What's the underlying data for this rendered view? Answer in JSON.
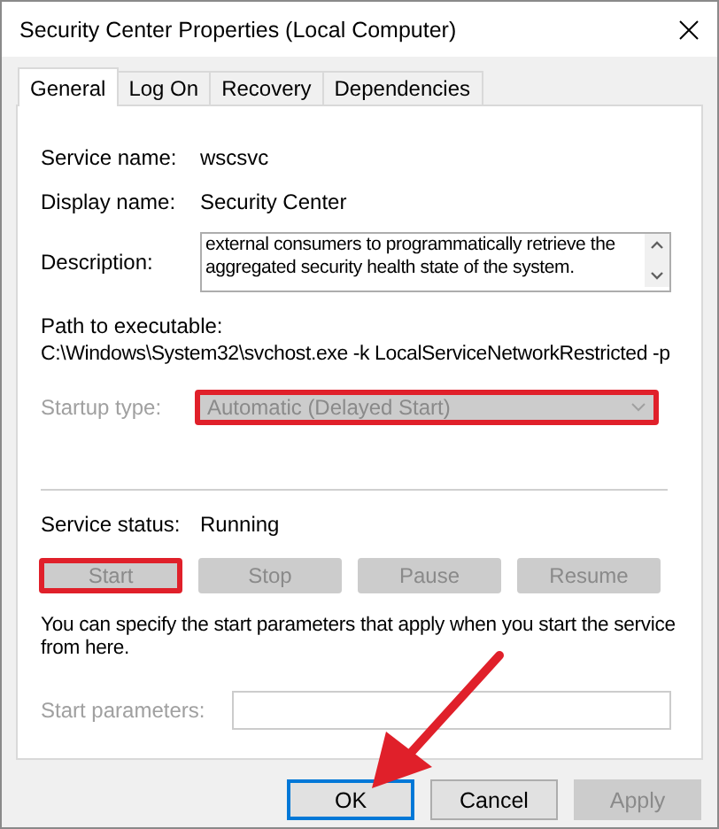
{
  "window": {
    "title": "Security Center Properties (Local Computer)"
  },
  "tabs": [
    {
      "label": "General",
      "selected": true
    },
    {
      "label": "Log On",
      "selected": false
    },
    {
      "label": "Recovery",
      "selected": false
    },
    {
      "label": "Dependencies",
      "selected": false
    }
  ],
  "fields": [
    {
      "kind": "text",
      "label": "Service name:",
      "value": "wscsvc"
    },
    {
      "kind": "text",
      "label": "Display name:",
      "value": "Security Center"
    },
    {
      "kind": "textarea",
      "label": "Description:",
      "value": "external consumers to programmatically retrieve the aggregated security health state of the system."
    }
  ],
  "path": {
    "label": "Path to executable:",
    "value": "C:\\Windows\\System32\\svchost.exe -k LocalServiceNetworkRestricted -p"
  },
  "startup": {
    "label": "Startup type:",
    "value": "Automatic (Delayed Start)",
    "disabled": true,
    "highlighted": true
  },
  "status": {
    "label": "Service status:",
    "value": "Running"
  },
  "service_buttons": [
    {
      "label": "Start",
      "disabled": true,
      "highlighted": true
    },
    {
      "label": "Stop",
      "disabled": true,
      "highlighted": false
    },
    {
      "label": "Pause",
      "disabled": true,
      "highlighted": false
    },
    {
      "label": "Resume",
      "disabled": true,
      "highlighted": false
    }
  ],
  "hint": "You can specify the start parameters that apply when you start the service from here.",
  "start_parameters": {
    "label": "Start parameters:",
    "disabled": true
  },
  "dialog_buttons": [
    {
      "label": "OK",
      "default": true,
      "disabled": false
    },
    {
      "label": "Cancel",
      "default": false,
      "disabled": false
    },
    {
      "label": "Apply",
      "default": false,
      "disabled": true
    }
  ],
  "annotation": {
    "kind": "arrow"
  }
}
